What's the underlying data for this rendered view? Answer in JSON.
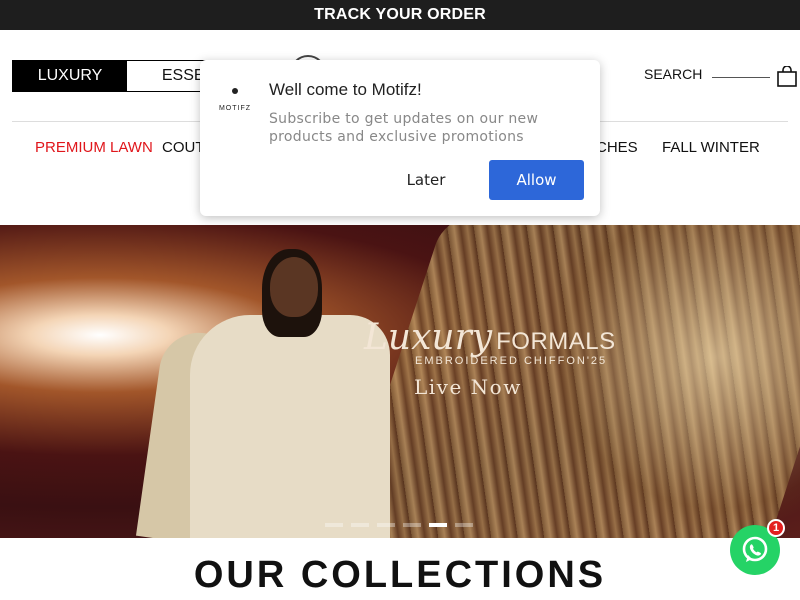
{
  "announcement": {
    "text": "TRACK YOUR ORDER"
  },
  "segments": {
    "active": "LUXURY",
    "inactive": "ESSEN"
  },
  "header": {
    "search_label": "SEARCH"
  },
  "nav": [
    {
      "label": "PREMIUM LAWN"
    },
    {
      "label": "COUT"
    },
    {
      "label": "CHES"
    },
    {
      "label": "FALL WINTER"
    }
  ],
  "hero": {
    "title_script": "Luxury",
    "title_caps": "FORMALS",
    "subtitle": "EMBROIDERED CHIFFON'25",
    "cta": "Live Now"
  },
  "carousel": {
    "count": 6,
    "active_index": 4
  },
  "section": {
    "title": "OUR COLLECTIONS"
  },
  "whatsapp": {
    "badge": "1"
  },
  "popup": {
    "logo_text": "MOTIFZ",
    "title": "Well come to Motifz!",
    "message": "Subscribe to get updates on our new products and exclusive promotions",
    "later_label": "Later",
    "allow_label": "Allow"
  },
  "colors": {
    "accent_red": "#e0161b",
    "allow_blue": "#2d67d9",
    "whatsapp_green": "#25d366"
  }
}
